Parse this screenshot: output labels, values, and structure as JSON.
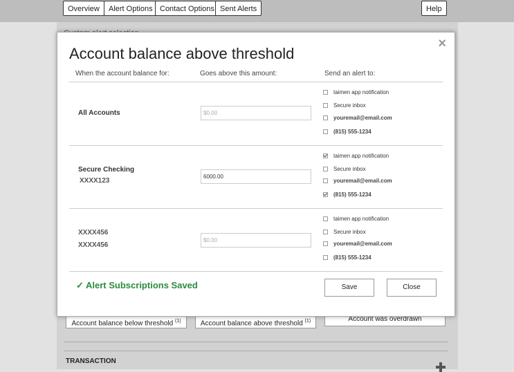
{
  "nav": {
    "overview": "Overview",
    "alert_options": "Alert Options",
    "contact_options": "Contact Options",
    "sent_alerts": "Sent Alerts",
    "help": "Help"
  },
  "page": {
    "heading": "Custom alert selection",
    "below_threshold": "Account balance below threshold",
    "below_sup": "(1)",
    "above_threshold": "Account balance above threshold",
    "above_sup": "(1)",
    "overdrawn": "Account was overdrawn",
    "transaction_title": "TRANSACTION"
  },
  "modal": {
    "title": "Account balance above threshold",
    "col_account": "When the account balance for:",
    "col_amount": "Goes above this amount:",
    "col_alert": "Send an alert to:",
    "accounts": [
      {
        "line1": "All Accounts",
        "line2": "",
        "amount_value": "",
        "amount_placeholder": "$0.00",
        "options": [
          {
            "label": "taimen app notification",
            "checked": false
          },
          {
            "label": "Secure inbox",
            "checked": false
          },
          {
            "label": "youremail@email.com",
            "checked": false
          },
          {
            "label": "(815) 555-1234",
            "checked": false
          }
        ]
      },
      {
        "line1": "Secure Checking",
        "line2": "XXXX123",
        "amount_value": "6000.00",
        "amount_placeholder": "$0.00",
        "options": [
          {
            "label": "taimen app notification",
            "checked": true
          },
          {
            "label": "Secure inbox",
            "checked": false
          },
          {
            "label": "youremail@email.com",
            "checked": false
          },
          {
            "label": "(815) 555-1234",
            "checked": true
          }
        ]
      },
      {
        "line1": "XXXX456",
        "line2": "XXXX456",
        "amount_value": "",
        "amount_placeholder": "$0.00",
        "options": [
          {
            "label": "taimen app notification",
            "checked": false
          },
          {
            "label": "Secure inbox",
            "checked": false
          },
          {
            "label": "youremail@email.com",
            "checked": false
          },
          {
            "label": "(815) 555-1234",
            "checked": false
          }
        ]
      }
    ],
    "saved_message": "✓ Alert Subscriptions Saved",
    "save_label": "Save",
    "close_label": "Close",
    "close_icon": "×"
  },
  "colors": {
    "success": "#2d8a3e",
    "overlay": "#d2d2d2"
  }
}
